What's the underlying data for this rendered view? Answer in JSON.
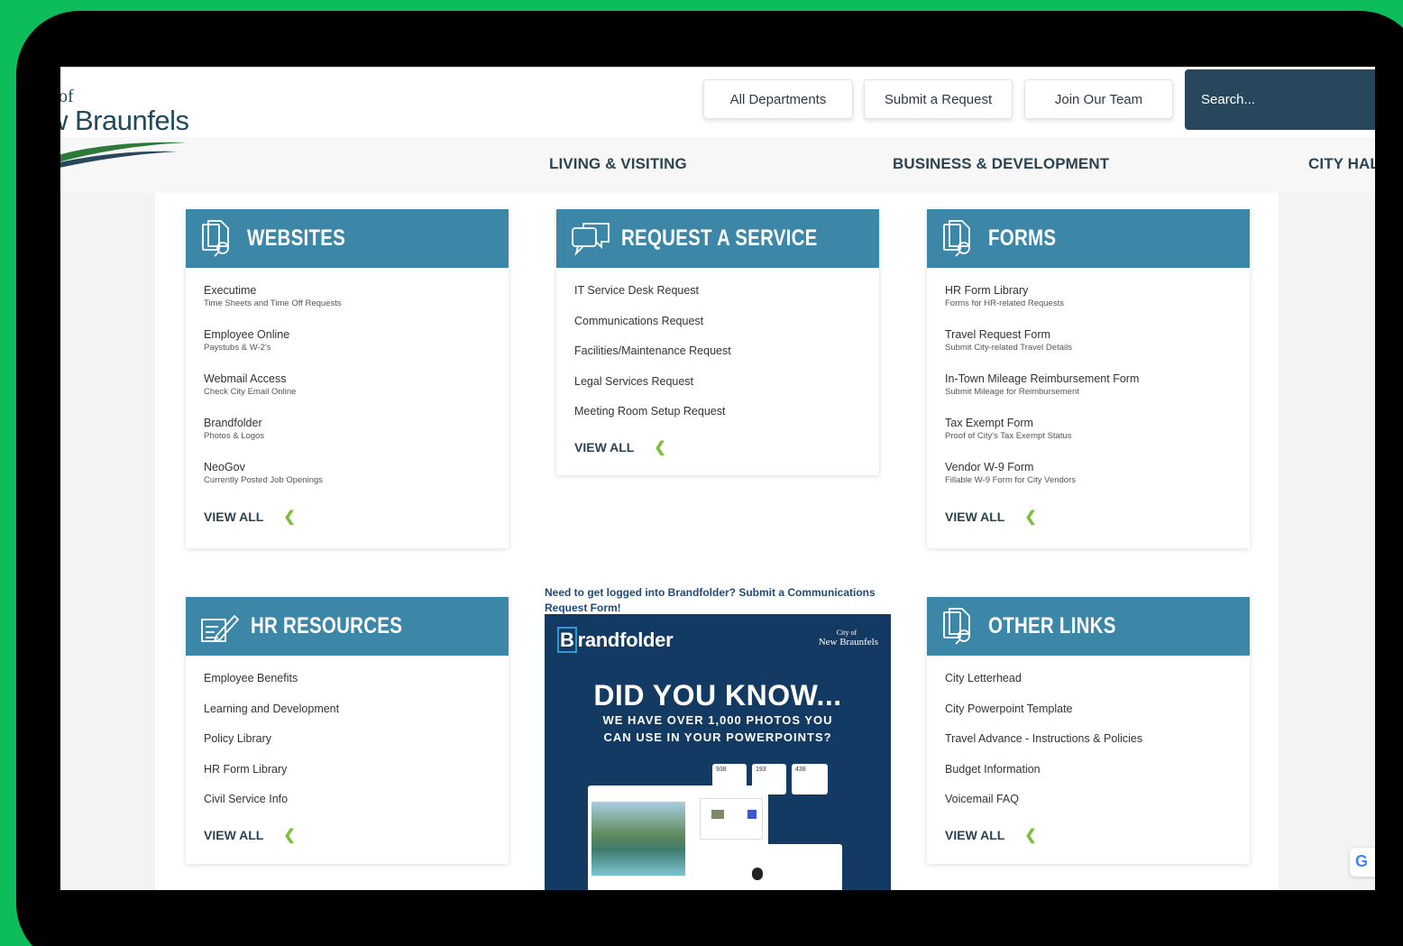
{
  "logo": {
    "line1": "of",
    "line2": "w Braunfels"
  },
  "utility_nav": [
    {
      "label": "All Departments"
    },
    {
      "label": "Submit a Request"
    },
    {
      "label": "Join Our Team"
    }
  ],
  "search": {
    "placeholder": "Search..."
  },
  "main_nav": [
    {
      "label": "LIVING & VISITING"
    },
    {
      "label": "BUSINESS & DEVELOPMENT"
    },
    {
      "label": "CITY HAL"
    }
  ],
  "cards": {
    "websites": {
      "title": "WEBSITES",
      "items": [
        {
          "title": "Executime",
          "sub": "Time Sheets and Time Off Requests"
        },
        {
          "title": "Employee Online",
          "sub": "Paystubs & W-2's"
        },
        {
          "title": "Webmail Access",
          "sub": "Check City Email Online"
        },
        {
          "title": "Brandfolder",
          "sub": "Photos & Logos"
        },
        {
          "title": "NeoGov",
          "sub": "Currently Posted Job Openings"
        }
      ],
      "view_all": "VIEW ALL"
    },
    "request": {
      "title": "REQUEST A SERVICE",
      "items": [
        "IT Service Desk Request",
        "Communications Request",
        "Facilities/Maintenance Request",
        "Legal Services Request",
        "Meeting Room Setup Request"
      ],
      "view_all": "VIEW ALL"
    },
    "forms": {
      "title": "FORMS",
      "items": [
        {
          "title": "HR Form Library",
          "sub": "Forms for HR-related Requests"
        },
        {
          "title": "Travel Request Form",
          "sub": "Submit City-related Travel Details"
        },
        {
          "title": "In-Town Mileage Reimbursement Form",
          "sub": "Submit Mileage for Reimbursement"
        },
        {
          "title": "Tax Exempt Form",
          "sub": "Proof of City's Tax Exempt Status"
        },
        {
          "title": "Vendor W-9 Form",
          "sub": "Fillable W-9 Form for City Vendors"
        }
      ],
      "view_all": "VIEW ALL"
    },
    "hr": {
      "title": "HR RESOURCES",
      "items": [
        "Employee Benefits",
        "Learning and Development",
        "Policy Library",
        "HR Form Library",
        "Civil Service Info"
      ],
      "view_all": "VIEW ALL"
    },
    "other": {
      "title": "OTHER LINKS",
      "items": [
        "City Letterhead",
        "City Powerpoint Template",
        "Travel Advance - Instructions & Policies",
        "Budget Information",
        "Voicemail FAQ"
      ],
      "view_all": "VIEW ALL"
    }
  },
  "promo": {
    "caption": "Need to get logged into Brandfolder? Submit a Communications Request Form!",
    "brand_b": "B",
    "brand_rest": "randfolder",
    "city_line1": "City of",
    "city_line2": "New Braunfels",
    "headline": "DID YOU KNOW...",
    "sub1": "WE HAVE OVER 1,000 PHOTOS YOU",
    "sub2": "CAN USE IN YOUR POWERPOINTS?",
    "stats": [
      "938",
      "193",
      "438"
    ]
  },
  "google_badge": "G",
  "colors": {
    "card_header": "#3c86a8",
    "search_bg": "#27485c",
    "chevron": "#7bbf3a",
    "promo_bg": "#123a63"
  }
}
